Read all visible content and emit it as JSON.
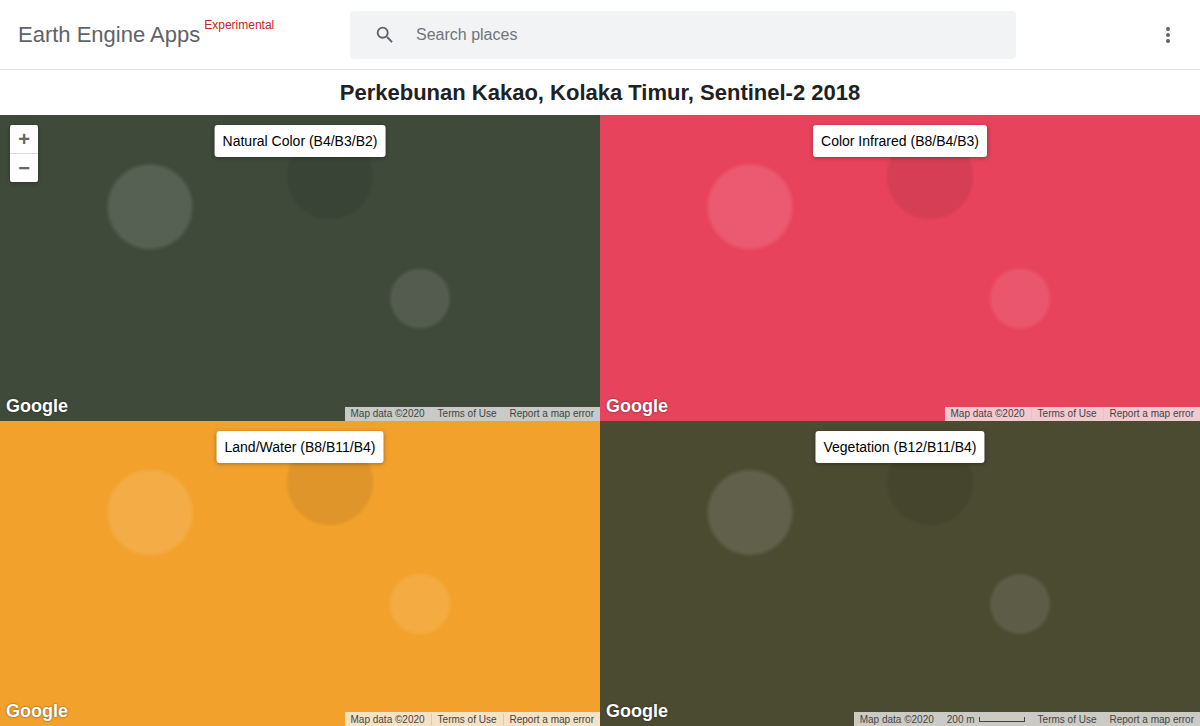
{
  "header": {
    "title": "Earth Engine Apps",
    "badge": "Experimental",
    "search": {
      "placeholder": "Search places"
    }
  },
  "title": "Perkebunan Kakao, Kolaka Timur, Sentinel-2 2018",
  "zoom": {
    "in": "+",
    "out": "−"
  },
  "attribution": {
    "logo": "Google",
    "map_data": "Map data ©2020",
    "terms": "Terms of Use",
    "report": "Report a map error"
  },
  "maps": [
    {
      "label": "Natural Color (B4/B3/B2)",
      "color": "#3f4a3b",
      "zoom_controls": true,
      "scale": ""
    },
    {
      "label": "Color Infrared (B8/B4/B3)",
      "color": "#e8435c",
      "zoom_controls": false,
      "scale": ""
    },
    {
      "label": "Land/Water (B8/B11/B4)",
      "color": "#f2a22c",
      "zoom_controls": false,
      "scale": ""
    },
    {
      "label": "Vegetation (B12/B11/B4)",
      "color": "#4b4b32",
      "zoom_controls": false,
      "scale": "200 m"
    }
  ]
}
